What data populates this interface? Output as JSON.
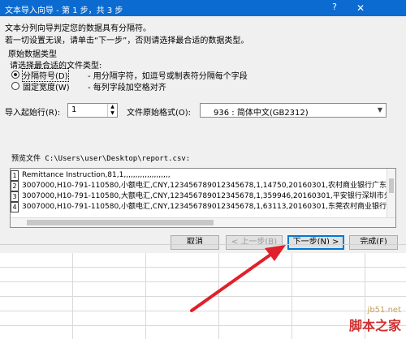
{
  "window": {
    "title": "文本导入向导 - 第 1 步，共 3 步",
    "help": "?",
    "close": "✕"
  },
  "intro": {
    "line1": "文本分列向导判定您的数据具有分隔符。",
    "line2": "若一切设置无误，请单击“下一步”，否则请选择最合适的数据类型。"
  },
  "original_type": {
    "group_label": "原始数据类型",
    "prompt": "请选择最合适的文件类型:",
    "options": [
      {
        "label": "分隔符号(D)",
        "desc": "- 用分隔字符，如逗号或制表符分隔每个字段",
        "selected": true
      },
      {
        "label": "固定宽度(W)",
        "desc": "- 每列字段加空格对齐",
        "selected": false
      }
    ]
  },
  "start_row": {
    "label": "导入起始行(R):",
    "value": "1"
  },
  "file_origin": {
    "label": "文件原始格式(O):",
    "value": "936 : 简体中文(GB2312)"
  },
  "preview": {
    "label": "预览文件 C:\\Users\\user\\Desktop\\report.csv:",
    "lines": [
      {
        "num": "1",
        "text": "Remittance Instruction,81,1,,,,,,,,,,,,,,,,,,,,"
      },
      {
        "num": "2",
        "text": "3007000,H10-791-110580,小额电汇,CNY,12345678901234567​8,1,14750,20160301,农村商业银行广东省"
      },
      {
        "num": "3",
        "text": "3007000,H10-791-110580,大额电汇,CNY,12345678901234567​8,1,359946,20160301,平安银行深圳市分行"
      },
      {
        "num": "4",
        "text": "3007000,H10-791-110580,小额电汇,CNY,12345678901234567​8,1,63113,20160301,东莞农村商业银行长"
      }
    ]
  },
  "buttons": {
    "cancel": "取消",
    "back": "< 上一步(B)",
    "next": "下一步(N) >",
    "finish": "完成(F)"
  },
  "watermark": {
    "site": "jb51.net",
    "brand": "脚本之家"
  },
  "colors": {
    "titlebar": "#0b6bd0",
    "arrow": "#e0202a",
    "primary_border": "#0078d7"
  }
}
